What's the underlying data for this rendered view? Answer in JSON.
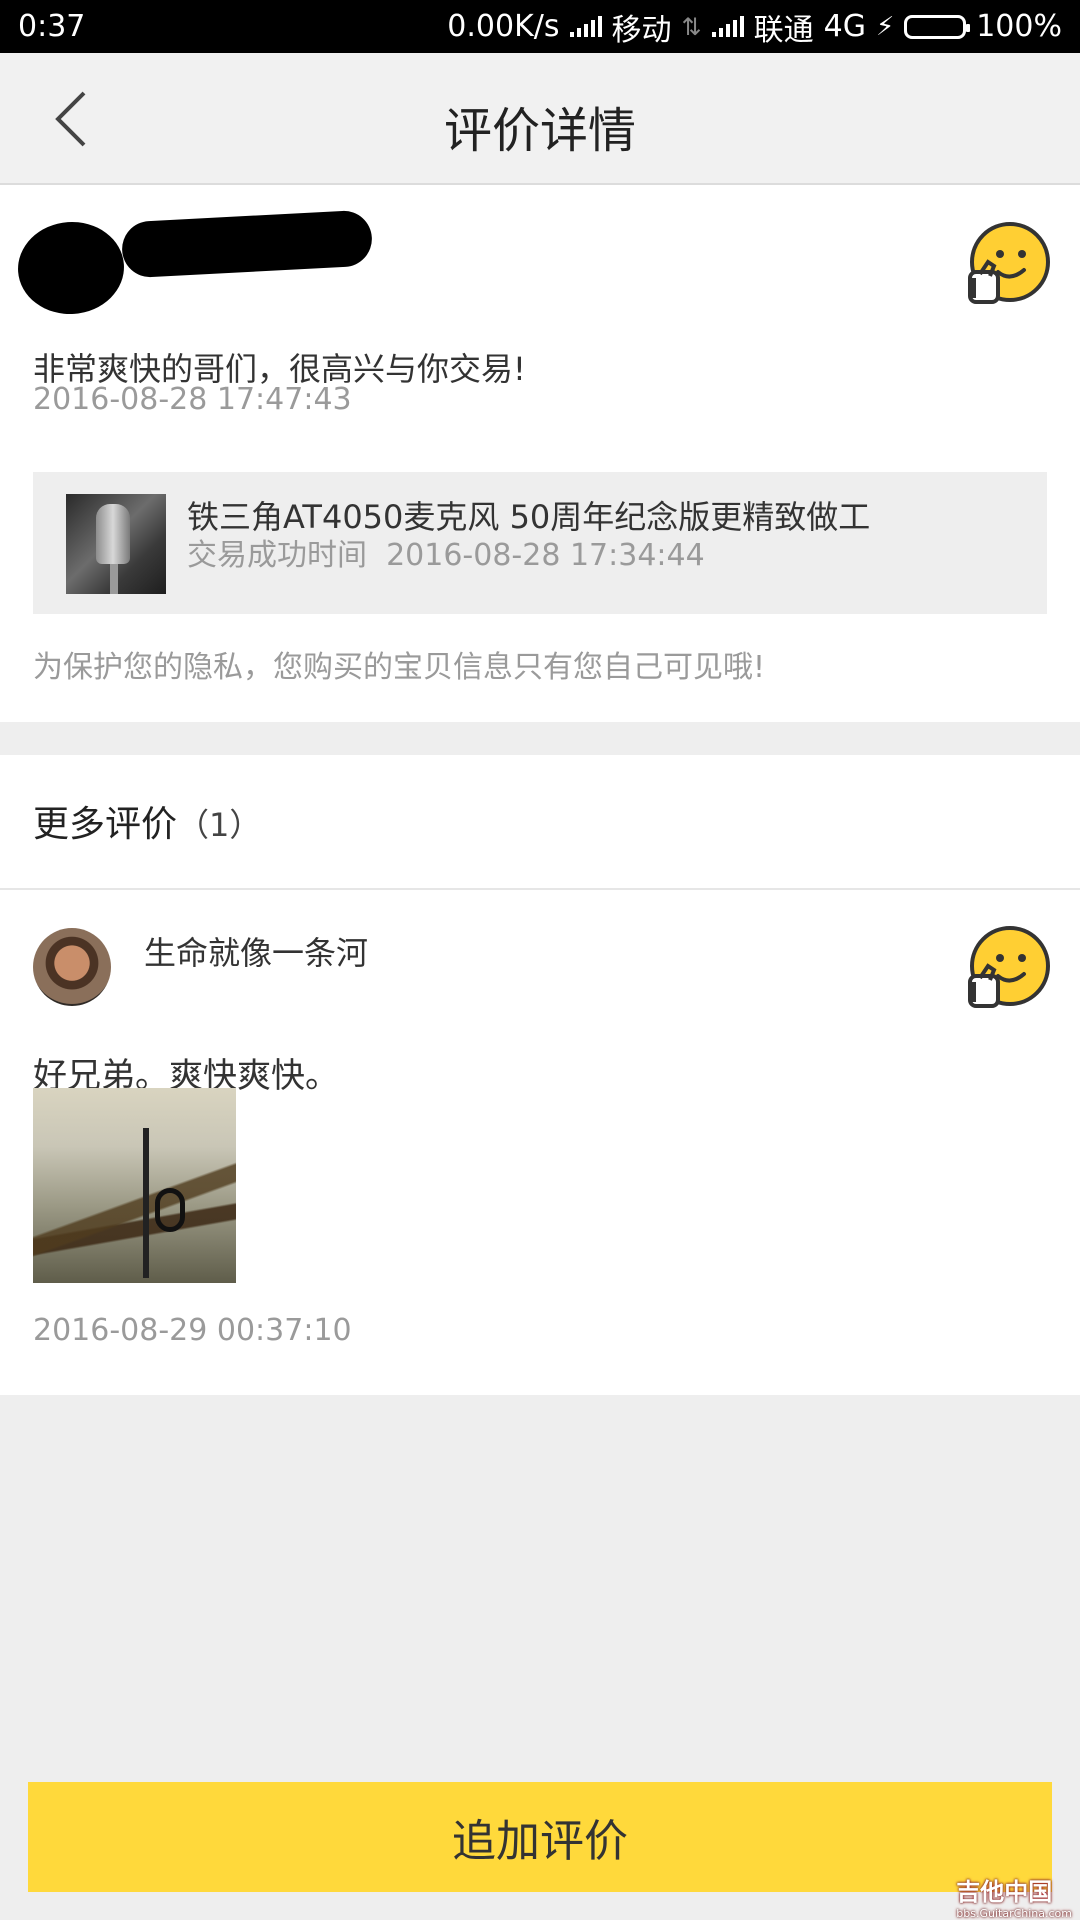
{
  "status_bar": {
    "time": "0:37",
    "speed": "0.00K/s",
    "carrier1": "移动",
    "carrier2": "联通",
    "network": "4G",
    "battery": "100%"
  },
  "nav": {
    "title": "评价详情",
    "back_icon": "chevron-left-icon"
  },
  "review": {
    "text": "非常爽快的哥们，很高兴与你交易!",
    "time": "2016-08-28 17:47:43",
    "product_title": "铁三角AT4050麦克风 50周年纪念版更精致做工",
    "product_success_label": "交易成功时间",
    "product_success_time": "2016-08-28 17:34:44",
    "privacy_note": "为保护您的隐私，您购买的宝贝信息只有您自己可见哦!",
    "rating_icon": "thumbs-up-emoji-icon"
  },
  "more_reviews": {
    "heading": "更多评价",
    "count": "（1）",
    "items": [
      {
        "username": "生命就像一条河",
        "comment": "好兄弟。爽快爽快。",
        "time": "2016-08-29 00:37:10"
      }
    ]
  },
  "footer": {
    "add_review_label": "追加评价",
    "watermark": "吉他中国",
    "watermark_sub": "bbs.GuitarChina.com"
  },
  "colors": {
    "accent": "#ffd93b",
    "background": "#eeeeee",
    "emoji_yellow": "#ffcf33"
  }
}
